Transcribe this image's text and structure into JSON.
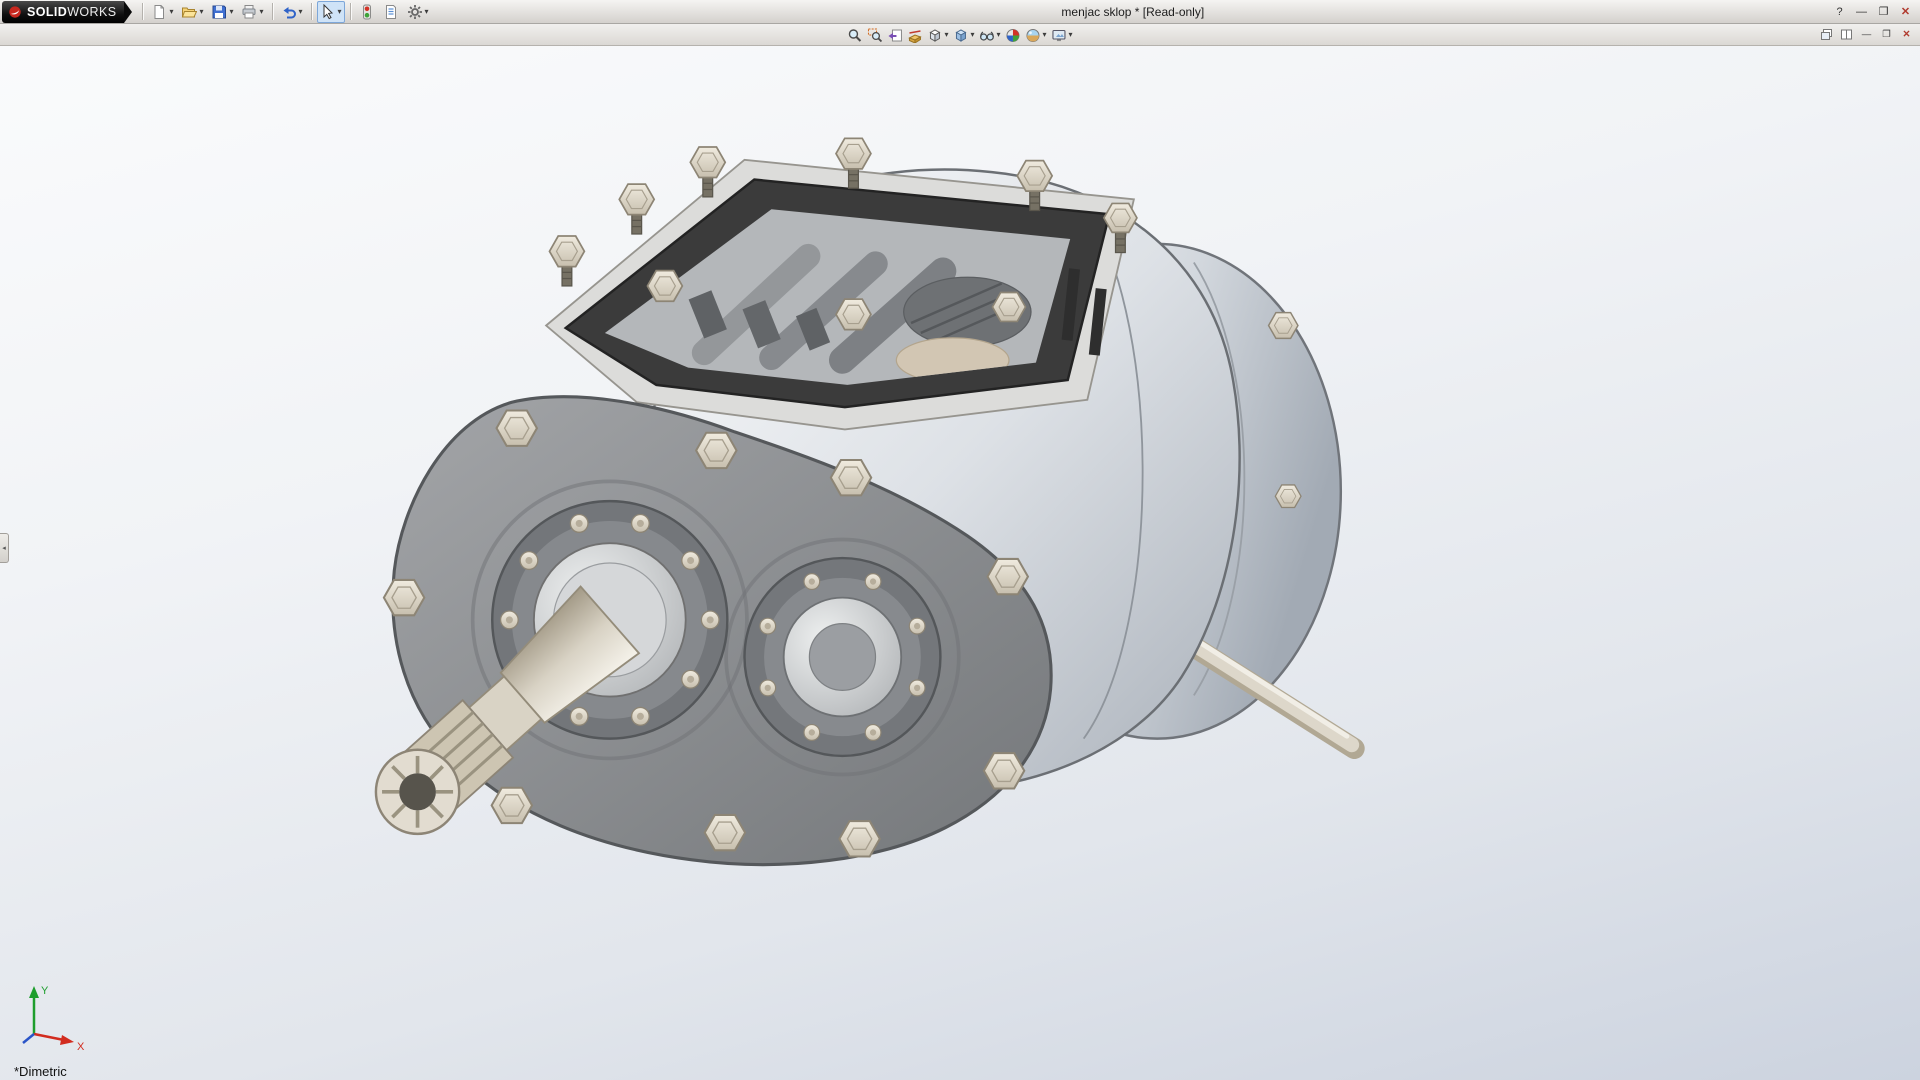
{
  "glyphs": {
    "caret": "▾",
    "panel_tab_arrow": "◂"
  },
  "titlebar": {
    "brand_bold": "SOLID",
    "brand_rest": "WORKS",
    "title": "menjac sklop * [Read-only]",
    "help_label": "?",
    "minimize_glyph": "—",
    "restore_glyph": "❐",
    "close_glyph": "✕"
  },
  "main_toolbar": {
    "items": [
      {
        "label": "New",
        "icon": "new-document-icon",
        "caret": true
      },
      {
        "label": "Open",
        "icon": "open-folder-icon",
        "caret": true
      },
      {
        "label": "Save",
        "icon": "save-icon",
        "caret": true
      },
      {
        "label": "Print",
        "icon": "print-icon",
        "caret": true
      },
      {
        "label": "Undo",
        "icon": "undo-icon",
        "caret": true
      },
      {
        "label": "Select",
        "icon": "select-cursor-icon",
        "caret": true,
        "active": true
      },
      {
        "label": "Rebuild",
        "icon": "rebuild-icon",
        "caret": false
      },
      {
        "label": "File Properties",
        "icon": "file-properties-icon",
        "caret": false
      },
      {
        "label": "Options",
        "icon": "options-icon",
        "caret": true
      }
    ]
  },
  "headsup_toolbar": {
    "items": [
      {
        "label": "Zoom to Fit",
        "icon": "zoom-to-fit-icon",
        "caret": false
      },
      {
        "label": "Zoom to Area",
        "icon": "zoom-to-area-icon",
        "caret": false
      },
      {
        "label": "Previous View",
        "icon": "previous-view-icon",
        "caret": false
      },
      {
        "label": "Section View",
        "icon": "section-view-icon",
        "caret": false
      },
      {
        "label": "View Orientation",
        "icon": "view-orientation-icon",
        "caret": true
      },
      {
        "label": "Display Style",
        "icon": "display-style-icon",
        "caret": true
      },
      {
        "label": "Hide/Show Items",
        "icon": "hide-show-items-icon",
        "caret": true
      },
      {
        "label": "Edit Appearance",
        "icon": "edit-appearance-icon",
        "caret": false
      },
      {
        "label": "Apply Scene",
        "icon": "apply-scene-icon",
        "caret": true
      },
      {
        "label": "View Settings",
        "icon": "view-settings-icon",
        "caret": true
      }
    ]
  },
  "document_window": {
    "minimize_glyph": "—",
    "restore_glyph": "❐",
    "close_glyph": "✕"
  },
  "viewport": {
    "view_label": "*Dimetric",
    "triad": {
      "x_label": "X",
      "y_label": "Y"
    }
  },
  "colors": {
    "titlebar_top": "#f5f4f2",
    "titlebar_bottom": "#d4d1cd",
    "brand_background": "#111111",
    "brand_logo_red": "#c8271e",
    "viewport_gradient_top": "#fafbfc",
    "viewport_gradient_bottom": "#ccd3df",
    "select_active_background": "#cfe3f7",
    "close_glyph_color": "#b03a2e",
    "triad_x_color": "#d22c1f",
    "triad_y_color": "#1e9e2d",
    "triad_z_color": "#2b55c8"
  }
}
